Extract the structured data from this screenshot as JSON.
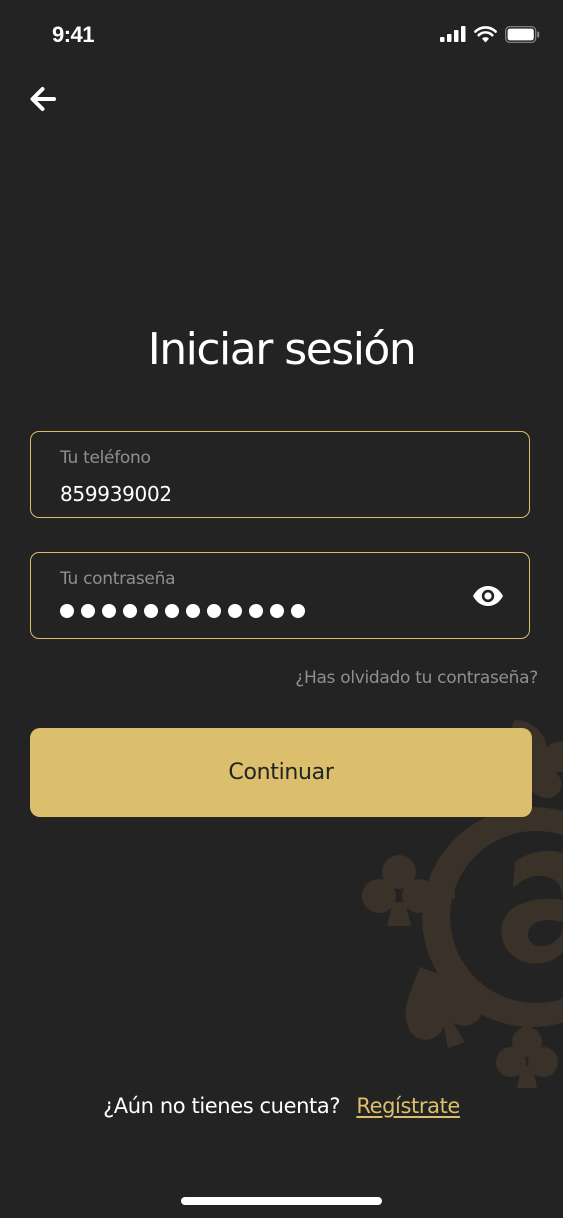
{
  "status_bar": {
    "time": "9:41"
  },
  "header": {
    "back_icon": "arrow-left-icon"
  },
  "login": {
    "title": "Iniciar sesión",
    "phone": {
      "label": "Tu teléfono",
      "value": "859939002"
    },
    "password": {
      "label": "Tu contraseña",
      "masked_length": 12,
      "toggle_icon": "eye-icon"
    },
    "forgot_password": "¿Has olvidado tu contraseña?",
    "continue_label": "Continuar"
  },
  "signup": {
    "prompt": "¿Aún no tienes cuenta?",
    "link": "Regístrate"
  },
  "colors": {
    "background": "#232323",
    "accent": "#dbbf6d",
    "muted_text": "#8f8f8f",
    "watermark": "#3a3128"
  }
}
